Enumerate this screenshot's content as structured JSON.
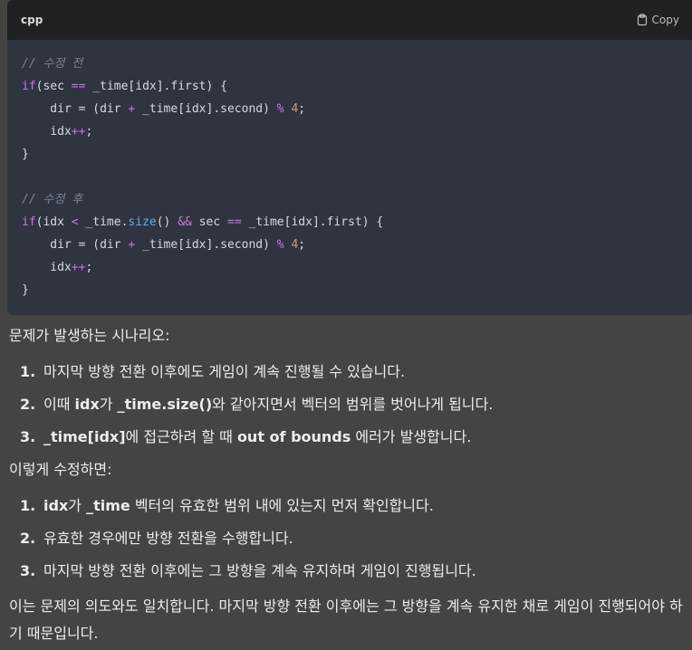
{
  "code_block": {
    "language": "cpp",
    "copy_label": "Copy",
    "lines": [
      {
        "parts": [
          {
            "t": "comment",
            "v": "// 수정 전"
          }
        ]
      },
      {
        "parts": [
          {
            "t": "kw",
            "v": "if"
          },
          {
            "t": "text",
            "v": "(sec "
          },
          {
            "t": "op",
            "v": "=="
          },
          {
            "t": "text",
            "v": " _time[idx].first) {"
          }
        ]
      },
      {
        "parts": [
          {
            "t": "text",
            "v": "    dir = (dir "
          },
          {
            "t": "op",
            "v": "+"
          },
          {
            "t": "text",
            "v": " _time[idx].second) "
          },
          {
            "t": "op",
            "v": "%"
          },
          {
            "t": "text",
            "v": " "
          },
          {
            "t": "num",
            "v": "4"
          },
          {
            "t": "text",
            "v": ";"
          }
        ]
      },
      {
        "parts": [
          {
            "t": "text",
            "v": "    idx"
          },
          {
            "t": "op",
            "v": "++"
          },
          {
            "t": "text",
            "v": ";"
          }
        ]
      },
      {
        "parts": [
          {
            "t": "text",
            "v": "}"
          }
        ]
      },
      {
        "parts": [
          {
            "t": "text",
            "v": ""
          }
        ]
      },
      {
        "parts": [
          {
            "t": "comment",
            "v": "// 수정 후"
          }
        ]
      },
      {
        "parts": [
          {
            "t": "kw",
            "v": "if"
          },
          {
            "t": "text",
            "v": "(idx "
          },
          {
            "t": "op",
            "v": "<"
          },
          {
            "t": "text",
            "v": " _time."
          },
          {
            "t": "func",
            "v": "size"
          },
          {
            "t": "text",
            "v": "() "
          },
          {
            "t": "op",
            "v": "&&"
          },
          {
            "t": "text",
            "v": " sec "
          },
          {
            "t": "op",
            "v": "=="
          },
          {
            "t": "text",
            "v": " _time[idx].first) {"
          }
        ]
      },
      {
        "parts": [
          {
            "t": "text",
            "v": "    dir = (dir "
          },
          {
            "t": "op",
            "v": "+"
          },
          {
            "t": "text",
            "v": " _time[idx].second) "
          },
          {
            "t": "op",
            "v": "%"
          },
          {
            "t": "text",
            "v": " "
          },
          {
            "t": "num",
            "v": "4"
          },
          {
            "t": "text",
            "v": ";"
          }
        ]
      },
      {
        "parts": [
          {
            "t": "text",
            "v": "    idx"
          },
          {
            "t": "op",
            "v": "++"
          },
          {
            "t": "text",
            "v": ";"
          }
        ]
      },
      {
        "parts": [
          {
            "t": "text",
            "v": "}"
          }
        ]
      }
    ]
  },
  "content": {
    "intro_problem": "문제가 발생하는 시나리오:",
    "problem_list": [
      {
        "num": "1.",
        "parts": [
          {
            "b": false,
            "v": "마지막 방향 전환 이후에도 게임이 계속 진행될 수 있습니다."
          }
        ]
      },
      {
        "num": "2.",
        "parts": [
          {
            "b": false,
            "v": "이때 "
          },
          {
            "b": true,
            "v": "idx"
          },
          {
            "b": false,
            "v": "가 "
          },
          {
            "b": true,
            "v": "_time.size()"
          },
          {
            "b": false,
            "v": "와 같아지면서 벡터의 범위를 벗어나게 됩니다."
          }
        ]
      },
      {
        "num": "3.",
        "parts": [
          {
            "b": true,
            "v": "_time[idx]"
          },
          {
            "b": false,
            "v": "에 접근하려 할 때 "
          },
          {
            "b": true,
            "v": "out of bounds"
          },
          {
            "b": false,
            "v": " 에러가 발생합니다."
          }
        ]
      }
    ],
    "intro_fix": "이렇게 수정하면:",
    "fix_list": [
      {
        "num": "1.",
        "parts": [
          {
            "b": true,
            "v": "idx"
          },
          {
            "b": false,
            "v": "가 "
          },
          {
            "b": true,
            "v": "_time"
          },
          {
            "b": false,
            "v": " 벡터의 유효한 범위 내에 있는지 먼저 확인합니다."
          }
        ]
      },
      {
        "num": "2.",
        "parts": [
          {
            "b": false,
            "v": "유효한 경우에만 방향 전환을 수행합니다."
          }
        ]
      },
      {
        "num": "3.",
        "parts": [
          {
            "b": false,
            "v": "마지막 방향 전환 이후에는 그 방향을 계속 유지하며 게임이 진행됩니다."
          }
        ]
      }
    ],
    "conclusion": "이는 문제의 의도와도 일치합니다. 마지막 방향 전환 이후에는 그 방향을 계속 유지한 채로 게임이 진행되어야 하기 때문입니다."
  }
}
